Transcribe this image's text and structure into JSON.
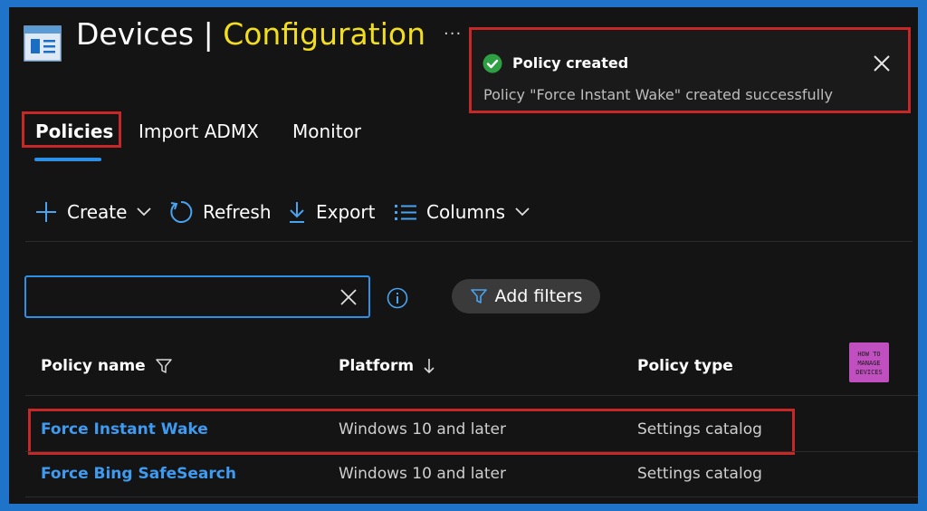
{
  "header": {
    "title_primary": "Devices",
    "title_separator": "|",
    "title_secondary": "Configuration",
    "more": "...",
    "app_icon": "configuration-page-icon"
  },
  "toast": {
    "title": "Policy created",
    "message": "Policy \"Force Instant Wake\" created successfully",
    "status_icon": "success-check-icon",
    "status_color": "#2ea043"
  },
  "tabs": [
    {
      "label": "Policies",
      "selected": true
    },
    {
      "label": "Import ADMX",
      "selected": false
    },
    {
      "label": "Monitor",
      "selected": false
    }
  ],
  "commands": {
    "create": "Create",
    "refresh": "Refresh",
    "export": "Export",
    "columns": "Columns"
  },
  "search": {
    "value": "",
    "placeholder": ""
  },
  "filters": {
    "label": "Add filters"
  },
  "table": {
    "columns": [
      "Policy name",
      "Platform",
      "Policy type"
    ],
    "rows": [
      {
        "name": "Force Instant Wake",
        "platform": "Windows 10 and later",
        "type": "Settings catalog",
        "highlighted": true
      },
      {
        "name": "Force Bing SafeSearch",
        "platform": "Windows 10 and later",
        "type": "Settings catalog",
        "highlighted": false
      }
    ]
  },
  "logo": {
    "line1": "HOW TO",
    "line2": "MANAGE",
    "line3": "DEVICES"
  },
  "colors": {
    "accent": "#2e8fe6",
    "title_highlight": "#f2de1e",
    "annotation_red": "#c62828",
    "link": "#3e9bf2"
  }
}
